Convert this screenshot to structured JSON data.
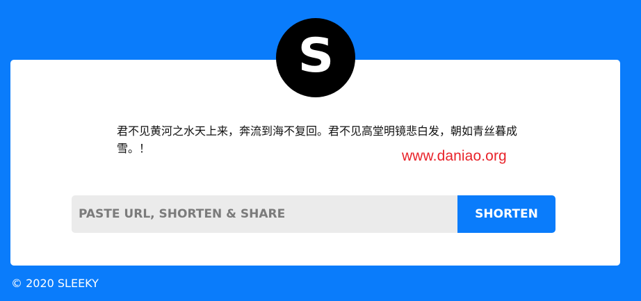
{
  "brand": {
    "logo_letter": "S",
    "primary_color": "#0a7cfb"
  },
  "intro": {
    "text": "君不见黄河之水天上来，奔流到海不复回。君不见高堂明镜悲白发，朝如青丝暮成雪。！"
  },
  "watermark": {
    "text": "www.daniao.org",
    "color": "#e8232a"
  },
  "form": {
    "url_input": {
      "placeholder": "PASTE URL, SHORTEN & SHARE",
      "value": ""
    },
    "shorten_label": "SHORTEN"
  },
  "footer": {
    "copyright": "© 2020 SLEEKY"
  }
}
